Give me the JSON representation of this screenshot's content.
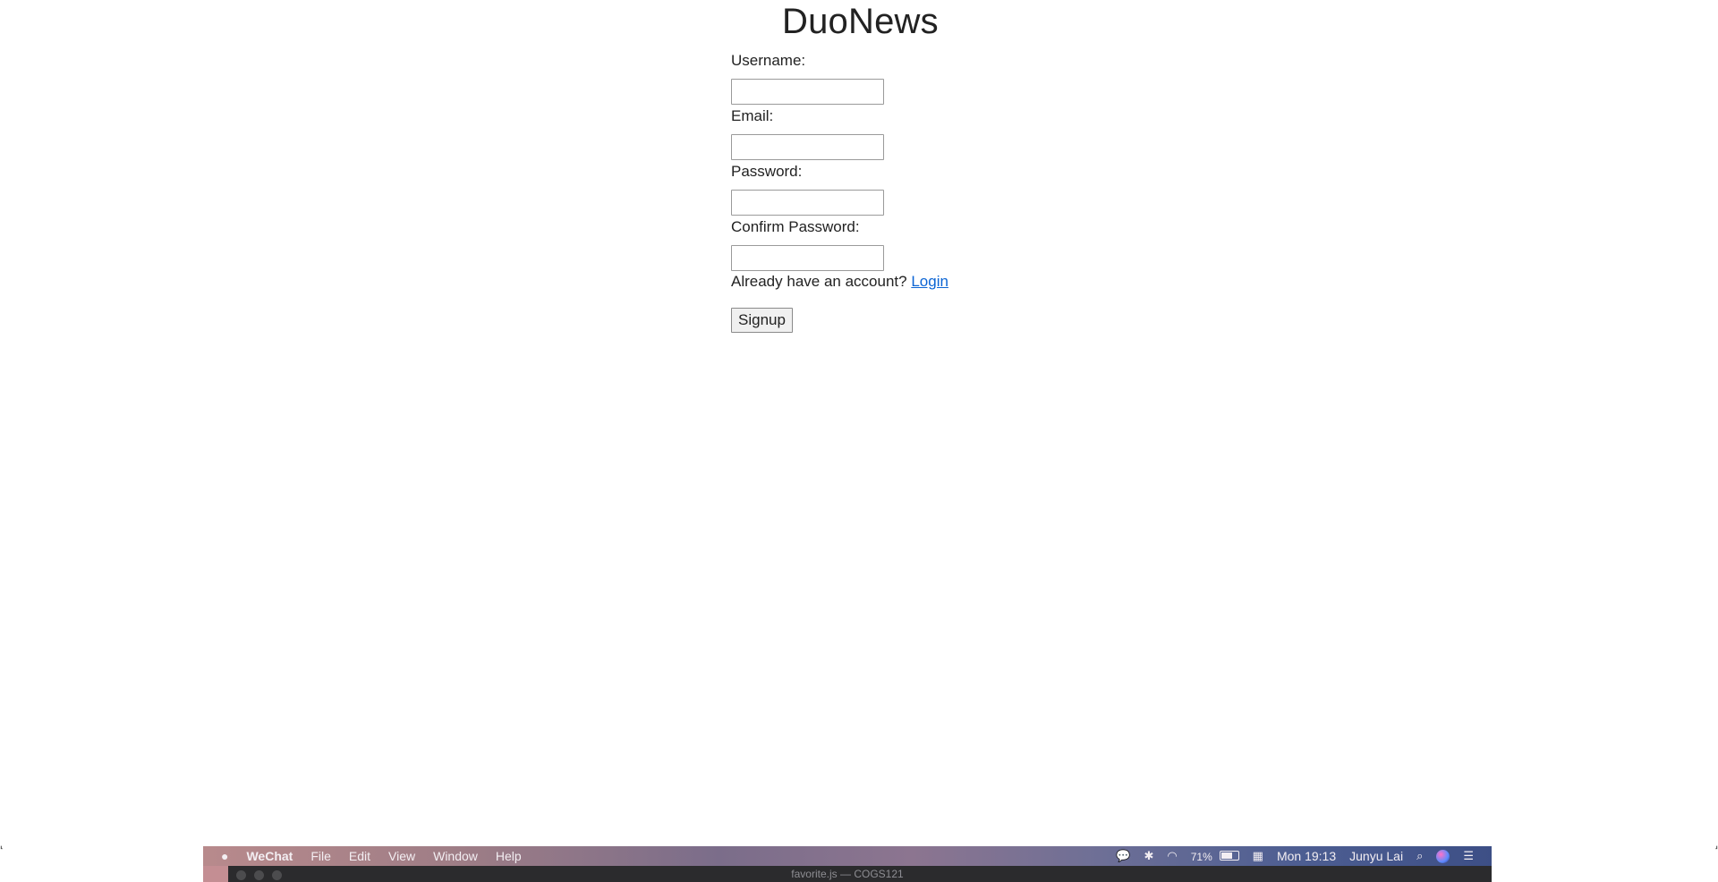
{
  "site": {
    "title": "DuoNews"
  },
  "form": {
    "fields": [
      {
        "label": "Username:",
        "value": "",
        "placeholder": ""
      },
      {
        "label": "Email:",
        "value": "",
        "placeholder": ""
      },
      {
        "label": "Password:",
        "value": "",
        "placeholder": ""
      },
      {
        "label": "Confirm Password:",
        "value": "",
        "placeholder": ""
      }
    ],
    "login_prompt": "Already have an account?",
    "login_link": "Login",
    "submit_label": "Signup"
  },
  "menubar": {
    "app_name": "WeChat",
    "menus": [
      "File",
      "Edit",
      "View",
      "Window",
      "Help"
    ],
    "battery_percent": "71%",
    "clock": "Mon 19:13",
    "user": "Junyu Lai",
    "icons": [
      "apple-icon",
      "wechat-icon",
      "bluetooth-icon",
      "wifi-icon",
      "battery-icon",
      "input-method-icon",
      "search-icon",
      "siri-icon",
      "notification-center-icon"
    ]
  },
  "editor": {
    "window_title": "favorite.js — COGS121"
  },
  "colors": {
    "link": "#0b64d4",
    "text": "#222222",
    "input_border": "#9a9a9a"
  }
}
